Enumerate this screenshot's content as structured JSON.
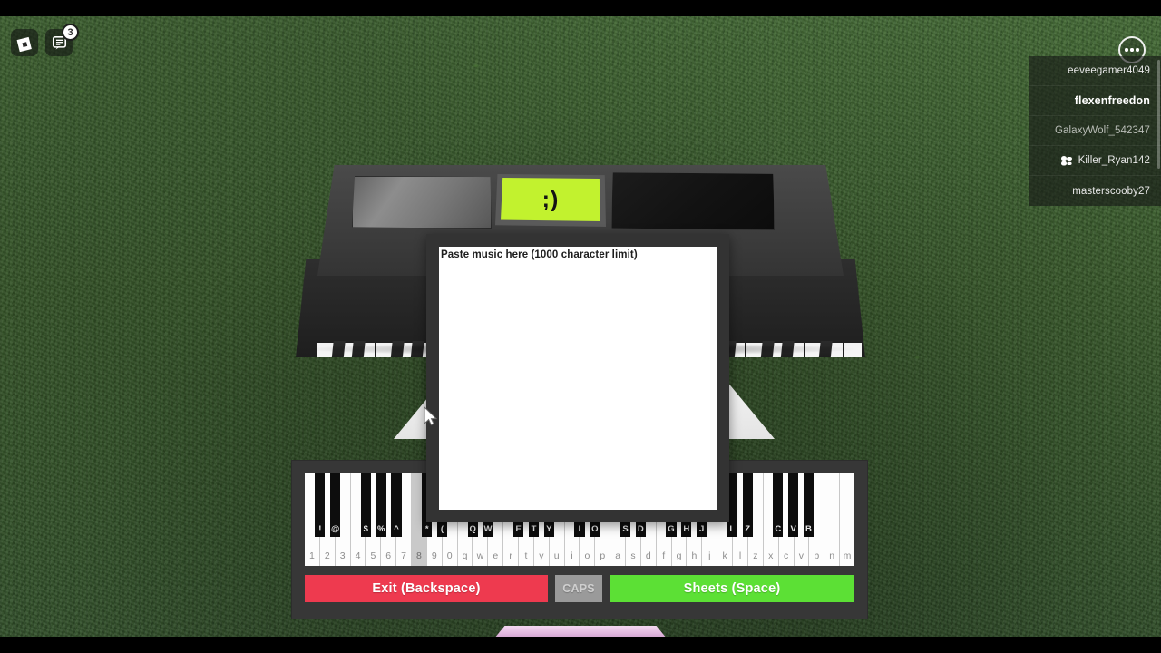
{
  "game": {
    "title": "Roblox Piano",
    "scene": "grass-field"
  },
  "topbar": {
    "roblox_icon": "roblox-logo-icon",
    "chat_icon": "chat-icon",
    "chat_badge": "3",
    "menu_icon": "more-options-icon"
  },
  "player_list": {
    "players": [
      {
        "name": "eeveegamer4049",
        "style": "normal",
        "friend": false
      },
      {
        "name": "flexenfreedon",
        "style": "bold",
        "friend": false
      },
      {
        "name": "GalaxyWolf_542347",
        "style": "dim",
        "friend": false
      },
      {
        "name": "Killer_Ryan142",
        "style": "normal",
        "friend": true
      },
      {
        "name": "masterscooby27",
        "style": "normal",
        "friend": false
      }
    ]
  },
  "piano_prop": {
    "display_text": ";)",
    "display_color": "#c2f22e",
    "body_color": "#3e3e3e"
  },
  "paste_dialog": {
    "label": "Paste music here (1000 character limit)",
    "value": "",
    "placeholder": ""
  },
  "keyboard": {
    "white_keys": [
      {
        "label": "1",
        "active": false
      },
      {
        "label": "2",
        "active": false
      },
      {
        "label": "3",
        "active": false
      },
      {
        "label": "4",
        "active": false
      },
      {
        "label": "5",
        "active": false
      },
      {
        "label": "6",
        "active": false
      },
      {
        "label": "7",
        "active": false
      },
      {
        "label": "8",
        "active": true
      },
      {
        "label": "9",
        "active": false
      },
      {
        "label": "0",
        "active": false
      },
      {
        "label": "q",
        "active": false
      },
      {
        "label": "w",
        "active": false
      },
      {
        "label": "e",
        "active": false
      },
      {
        "label": "r",
        "active": false
      },
      {
        "label": "t",
        "active": false
      },
      {
        "label": "y",
        "active": false
      },
      {
        "label": "u",
        "active": false
      },
      {
        "label": "i",
        "active": false
      },
      {
        "label": "o",
        "active": false
      },
      {
        "label": "p",
        "active": false
      },
      {
        "label": "a",
        "active": false
      },
      {
        "label": "s",
        "active": false
      },
      {
        "label": "d",
        "active": false
      },
      {
        "label": "f",
        "active": false
      },
      {
        "label": "g",
        "active": false
      },
      {
        "label": "h",
        "active": false
      },
      {
        "label": "j",
        "active": false
      },
      {
        "label": "k",
        "active": false
      },
      {
        "label": "l",
        "active": false
      },
      {
        "label": "z",
        "active": false
      },
      {
        "label": "x",
        "active": false
      },
      {
        "label": "c",
        "active": false
      },
      {
        "label": "v",
        "active": false
      },
      {
        "label": "b",
        "active": false
      },
      {
        "label": "n",
        "active": false
      },
      {
        "label": "m",
        "active": false
      }
    ],
    "black_keys": [
      {
        "label": "!",
        "after": 0
      },
      {
        "label": "@",
        "after": 1
      },
      {
        "label": "$",
        "after": 3
      },
      {
        "label": "%",
        "after": 4
      },
      {
        "label": "^",
        "after": 5
      },
      {
        "label": "*",
        "after": 7
      },
      {
        "label": "(",
        "after": 8
      },
      {
        "label": "Q",
        "after": 10
      },
      {
        "label": "W",
        "after": 11
      },
      {
        "label": "E",
        "after": 13
      },
      {
        "label": "T",
        "after": 14
      },
      {
        "label": "Y",
        "after": 15
      },
      {
        "label": "I",
        "after": 17
      },
      {
        "label": "O",
        "after": 18
      },
      {
        "label": "S",
        "after": 20
      },
      {
        "label": "D",
        "after": 21
      },
      {
        "label": "G",
        "after": 23
      },
      {
        "label": "H",
        "after": 24
      },
      {
        "label": "J",
        "after": 25
      },
      {
        "label": "L",
        "after": 27
      },
      {
        "label": "Z",
        "after": 28
      },
      {
        "label": "C",
        "after": 30
      },
      {
        "label": "V",
        "after": 31
      },
      {
        "label": "B",
        "after": 32
      }
    ]
  },
  "controls": {
    "exit_label": "Exit (Backspace)",
    "caps_label": "CAPS",
    "sheets_label": "Sheets (Space)",
    "exit_color": "#ee3a4f",
    "caps_color": "#9a9a9a",
    "sheets_color": "#5ce035"
  }
}
